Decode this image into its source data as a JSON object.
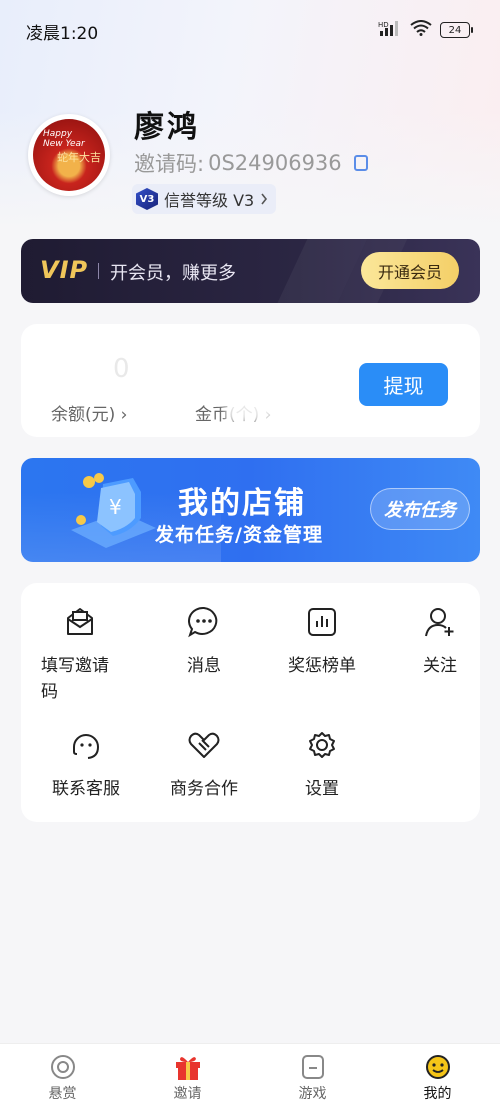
{
  "status_bar": {
    "time": "凌晨1:20",
    "battery": "24",
    "hd": "HD"
  },
  "profile": {
    "name": "廖鸿",
    "invite_label": "邀请码:",
    "invite_code": "0S24906936",
    "level_badge": "V3",
    "level_text": "信誉等级 V3",
    "avatar_line1": "Happy",
    "avatar_line2": "New Year",
    "avatar_cn": "蛇年大吉"
  },
  "vip": {
    "logo": "VIP",
    "text": "开会员，赚更多",
    "button": "开通会员"
  },
  "balance": {
    "value": "0",
    "balance_label": "余额(元)",
    "gold_label": "金币(个)",
    "withdraw": "提现"
  },
  "shop_banner": {
    "title": "我的店铺",
    "subtitle": "发布任务/资金管理",
    "button": "发布任务"
  },
  "menu": [
    {
      "label": "填写邀请码",
      "icon": "mail-icon"
    },
    {
      "label": "消息",
      "icon": "chat-bubble-icon"
    },
    {
      "label": "奖惩榜单",
      "icon": "chart-board-icon"
    },
    {
      "label": "关注",
      "icon": "follow-user-icon"
    },
    {
      "label": "联系客服",
      "icon": "headset-icon"
    },
    {
      "label": "商务合作",
      "icon": "handshake-icon"
    },
    {
      "label": "设置",
      "icon": "gear-icon"
    }
  ],
  "tabs": [
    {
      "label": "悬赏",
      "icon": "target-icon",
      "active": false
    },
    {
      "label": "邀请",
      "icon": "gift-icon",
      "active": false
    },
    {
      "label": "游戏",
      "icon": "game-icon",
      "active": false
    },
    {
      "label": "我的",
      "icon": "smiley-icon",
      "active": true
    }
  ],
  "colors": {
    "accent": "#2a8df7",
    "vip_gold": "#f0c65a",
    "gift_red": "#e8352e",
    "smiley_yellow": "#f5c518"
  }
}
